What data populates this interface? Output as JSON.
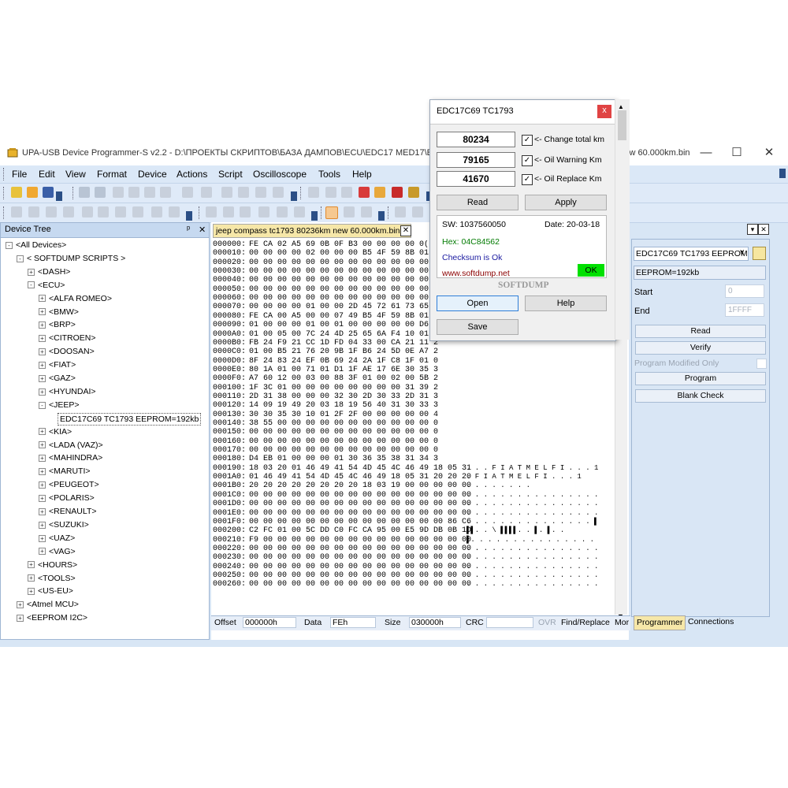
{
  "window": {
    "title": "UPA-USB Device Programmer-S v2.2 - D:\\ПРОЕКТЫ СКРИПТОВ\\БАЗА ДАМПОВ\\ECU\\EDC17 MED17\\EDC17C69\\JEEP\\jeep compass tc1793 80236km new 60.000km.bin",
    "minimize": "—",
    "maximize": "☐",
    "close": "✕"
  },
  "menu": [
    "File",
    "Edit",
    "View",
    "Format",
    "Device",
    "Actions",
    "Script",
    "Oscilloscope",
    "Tools",
    "Help"
  ],
  "device_tree": {
    "title": "Device Tree",
    "pin": "ᵖ",
    "close": "✕",
    "items": [
      {
        "label": "<All Devices>",
        "level": 0,
        "sign": "-"
      },
      {
        "label": "< SOFTDUMP SCRIPTS >",
        "level": 1,
        "sign": "-"
      },
      {
        "label": "<DASH>",
        "level": 2,
        "sign": "+"
      },
      {
        "label": "<ECU>",
        "level": 2,
        "sign": "-"
      },
      {
        "label": "<ALFA ROMEO>",
        "level": 3,
        "sign": "+"
      },
      {
        "label": "<BMW>",
        "level": 3,
        "sign": "+"
      },
      {
        "label": "<BRP>",
        "level": 3,
        "sign": "+"
      },
      {
        "label": "<CITROEN>",
        "level": 3,
        "sign": "+"
      },
      {
        "label": "<DOOSAN>",
        "level": 3,
        "sign": "+"
      },
      {
        "label": "<FIAT>",
        "level": 3,
        "sign": "+"
      },
      {
        "label": "<GAZ>",
        "level": 3,
        "sign": "+"
      },
      {
        "label": "<HYUNDAI>",
        "level": 3,
        "sign": "+"
      },
      {
        "label": "<JEEP>",
        "level": 3,
        "sign": "-"
      },
      {
        "label": "EDC17C69 TC1793 EEPROM=192kb",
        "level": 4,
        "sign": "",
        "selected": true
      },
      {
        "label": "<KIA>",
        "level": 3,
        "sign": "+"
      },
      {
        "label": "<LADA (VAZ)>",
        "level": 3,
        "sign": "+"
      },
      {
        "label": "<MAHINDRA>",
        "level": 3,
        "sign": "+"
      },
      {
        "label": "<MARUTI>",
        "level": 3,
        "sign": "+"
      },
      {
        "label": "<PEUGEOT>",
        "level": 3,
        "sign": "+"
      },
      {
        "label": "<POLARIS>",
        "level": 3,
        "sign": "+"
      },
      {
        "label": "<RENAULT>",
        "level": 3,
        "sign": "+"
      },
      {
        "label": "<SUZUKI>",
        "level": 3,
        "sign": "+"
      },
      {
        "label": "<UAZ>",
        "level": 3,
        "sign": "+"
      },
      {
        "label": "<VAG>",
        "level": 3,
        "sign": "+"
      },
      {
        "label": "<HOURS>",
        "level": 2,
        "sign": "+"
      },
      {
        "label": "<TOOLS>",
        "level": 2,
        "sign": "+"
      },
      {
        "label": "<US-EU>",
        "level": 2,
        "sign": "+"
      },
      {
        "label": "<Atmel MCU>",
        "level": 1,
        "sign": "+"
      },
      {
        "label": "<EEPROM I2C>",
        "level": 1,
        "sign": "+"
      }
    ]
  },
  "hex_view": {
    "tab_label": "jeep compass tc1793 80236km new 60.000km.bin",
    "tab_close": "✕",
    "lines": [
      {
        "off": "000000:",
        "hex": "FE CA 02 A5 69 0B 0F B3 00 00 00 00 0(",
        "asc": ""
      },
      {
        "off": "000010:",
        "hex": "00 00 00 00 02 00 00 00 B5 4F 59 8B 01 0",
        "asc": ""
      },
      {
        "off": "000020:",
        "hex": "00 00 00 00 00 00 00 00 00 00 00 00 00 0",
        "asc": ""
      },
      {
        "off": "000030:",
        "hex": "00 00 00 00 00 00 00 00 00 00 00 00 00 0",
        "asc": ""
      },
      {
        "off": "000040:",
        "hex": "00 00 00 00 00 00 00 00 00 00 00 00 00 0",
        "asc": ""
      },
      {
        "off": "000050:",
        "hex": "00 00 00 00 00 00 00 00 00 00 00 00 00 0",
        "asc": ""
      },
      {
        "off": "000060:",
        "hex": "00 00 00 00 00 00 00 00 00 00 00 00 00 0",
        "asc": ""
      },
      {
        "off": "000070:",
        "hex": "00 00 00 00 01 00 00 2D 45 72 61 73 65 2(",
        "asc": ""
      },
      {
        "off": "000080:",
        "hex": "FE CA 00 A5 00 00 07 49 B5 4F 59 8B 01 0",
        "asc": ""
      },
      {
        "off": "000090:",
        "hex": "01 00 00 00 01 00 01 00 00 00 00 00 D6 2",
        "asc": ""
      },
      {
        "off": "0000A0:",
        "hex": "01 00 05 00 7C 24 4D 25 65 6A F4 10 01 0",
        "asc": ""
      },
      {
        "off": "0000B0:",
        "hex": "FB 24 F9 21 CC 1D FD 04 33 00 CA 21 11 2",
        "asc": ""
      },
      {
        "off": "0000C0:",
        "hex": "01 00 B5 21 76 20 9B 1F B6 24 5D 0E A7 2",
        "asc": ""
      },
      {
        "off": "0000D0:",
        "hex": "8F 24 83 24 EF 0B 69 24 2A 1F C8 1F 01 0",
        "asc": ""
      },
      {
        "off": "0000E0:",
        "hex": "80 1A 01 00 71 01 D1 1F AE 17 6E 30 35 3",
        "asc": ""
      },
      {
        "off": "0000F0:",
        "hex": "A7 60 12 00 03 00 88 3F 01 00 02 00 5B 2",
        "asc": ""
      },
      {
        "off": "000100:",
        "hex": "1F 3C 01 00 00 00 00 00 00 00 00 31 39 2",
        "asc": ""
      },
      {
        "off": "000110:",
        "hex": "2D 31 38 00 00 00 32 30 2D 30 33 2D 31 3",
        "asc": ""
      },
      {
        "off": "000120:",
        "hex": "14 09 19 49 20 03 18 19 56 40 31 30 33 3",
        "asc": ""
      },
      {
        "off": "000130:",
        "hex": "30 30 35 30 10 01 2F 2F 00 00 00 00 00 4",
        "asc": ""
      },
      {
        "off": "000140:",
        "hex": "38 55 00 00 00 00 00 00 00 00 00 00 00 0",
        "asc": ""
      },
      {
        "off": "000150:",
        "hex": "00 00 00 00 00 00 00 00 00 00 00 00 00 0",
        "asc": ""
      },
      {
        "off": "000160:",
        "hex": "00 00 00 00 00 00 00 00 00 00 00 00 00 0",
        "asc": ""
      },
      {
        "off": "000170:",
        "hex": "00 00 00 00 00 00 00 00 00 00 00 00 00 0",
        "asc": ""
      },
      {
        "off": "000180:",
        "hex": "D4 EB 01 00 00 00 01 30 36 35 38 31 34 3",
        "asc": ""
      },
      {
        "off": "000190:",
        "hex": "18 03 20 01 46 49 41 54 4D 45 4C 46 49 18 05 31",
        "asc": ". . . F I A T M E L F I . . . 1"
      },
      {
        "off": "0001A0:",
        "hex": "01 46 49 41 54 4D 45 4C 46 49 18 05 31 20 20 20",
        "asc": ". F I A T M E L F I . . . 1"
      },
      {
        "off": "0001B0:",
        "hex": "20 20 20 20 20 20 20 20 18 03 19 00 00 00 00 00",
        "asc": ". . . . . . . ."
      },
      {
        "off": "0001C0:",
        "hex": "00 00 00 00 00 00 00 00 00 00 00 00 00 00 00 00",
        "asc": ". . . . . . . . . . . . . . . ."
      },
      {
        "off": "0001D0:",
        "hex": "00 00 00 00 00 00 00 00 00 00 00 00 00 00 00 00",
        "asc": ". . . . . . . . . . . . . . . ."
      },
      {
        "off": "0001E0:",
        "hex": "00 00 00 00 00 00 00 00 00 00 00 00 00 00 00 00",
        "asc": ". . . . . . . . . . . . . . . ."
      },
      {
        "off": "0001F0:",
        "hex": "00 00 00 00 00 00 00 00 00 00 00 00 00 00 86 C6",
        "asc": ". . . . . . . . . . . . . . . ▌"
      },
      {
        "off": "000200:",
        "hex": "C2 FC 01 00 5C DD C0 FC CA 95 00 E5 9D DB 0B 1D",
        "asc": "▌▌. . \\ ▌▌▌▌. . ▌. ▌. ."
      },
      {
        "off": "000210:",
        "hex": "F9 00 00 00 00 00 00 00 00 00 00 00 00 00 00 00",
        "asc": "▌. . . . . . . . . . . . . . ."
      },
      {
        "off": "000220:",
        "hex": "00 00 00 00 00 00 00 00 00 00 00 00 00 00 00 00",
        "asc": ". . . . . . . . . . . . . . . ."
      },
      {
        "off": "000230:",
        "hex": "00 00 00 00 00 00 00 00 00 00 00 00 00 00 00 00",
        "asc": ". . . . . . . . . . . . . . . ."
      },
      {
        "off": "000240:",
        "hex": "00 00 00 00 00 00 00 00 00 00 00 00 00 00 00 00",
        "asc": ". . . . . . . . . . . . . . . ."
      },
      {
        "off": "000250:",
        "hex": "00 00 00 00 00 00 00 00 00 00 00 00 00 00 00 00",
        "asc": ". . . . . . . . . . . . . . . ."
      },
      {
        "off": "000260:",
        "hex": "00 00 00 00 00 00 00 00 00 00 00 00 00 00 00 00",
        "asc": ". . . . . . . . . . . . . . . ."
      }
    ]
  },
  "status": {
    "offset_label": "Offset",
    "offset_value": "000000h",
    "data_label": "Data",
    "data_value": "FEh",
    "size_label": "Size",
    "size_value": "030000h",
    "crc_label": "CRC",
    "crc_value": "",
    "ovr": "OVR",
    "find_replace": "Find/Replace",
    "more": "Mor"
  },
  "dialog": {
    "title": "EDC17C69 TC1793",
    "close": "x",
    "total_km": "80234",
    "total_label": "<- Change total km",
    "oil_warn_km": "79165",
    "oil_warn_label": "<- Oil Warning Km",
    "oil_replace_km": "41670",
    "oil_replace_label": "<- Oil Replace Km",
    "check": "✓",
    "read": "Read",
    "apply": "Apply",
    "sw": "SW: 1037560050",
    "date": "Date: 20-03-18",
    "hex": "Hex: 04C84562",
    "checksum": "Checksum is Ok",
    "url": "www.softdump.net",
    "ok": "OK",
    "brand": "SOFTDUMP",
    "open": "Open",
    "help": "Help",
    "save": "Save"
  },
  "programmer": {
    "device_select": "EDC17C69 TC1793 EEPROM",
    "eeprom_info": "EEPROM=192kb",
    "start_label": "Start",
    "start_value": "0",
    "end_label": "End",
    "end_value": "1FFFF",
    "read": "Read",
    "verify": "Verify",
    "program_modified": "Program Modified Only",
    "program": "Program",
    "blank_check": "Blank Check",
    "tab_programmer": "Programmer",
    "tab_connections": "Connections"
  },
  "colors": {
    "accent": "#2b579a",
    "ok_green": "#00e000",
    "hex_link": "#00008b",
    "url_red": "#8b0000",
    "hex_green": "#007a00"
  }
}
